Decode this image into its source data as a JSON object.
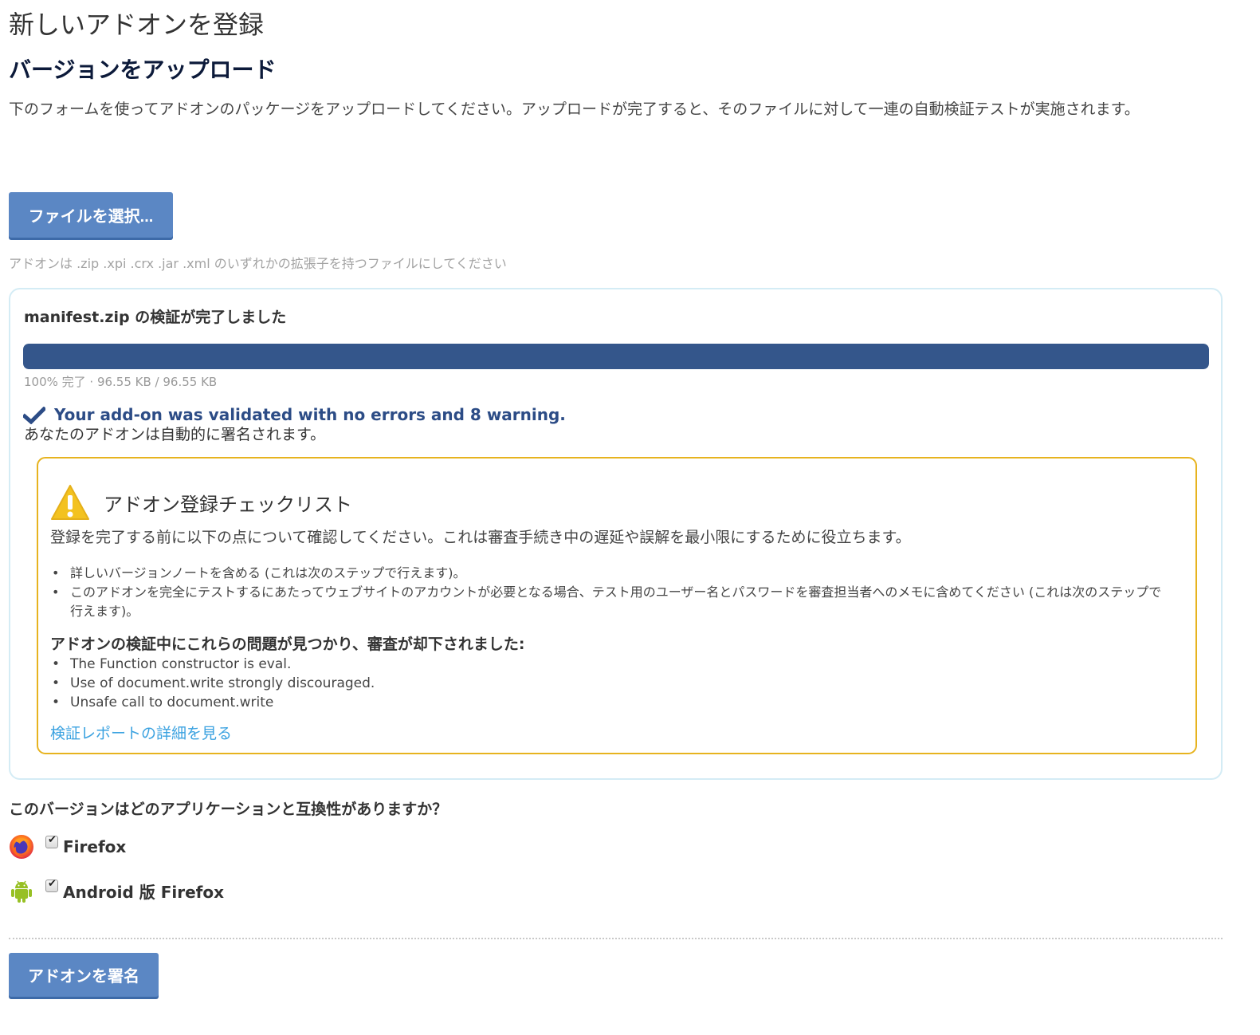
{
  "page": {
    "title": "新しいアドオンを登録",
    "section_title": "バージョンをアップロード",
    "intro": "下のフォームを使ってアドオンのパッケージをアップロードしてください。アップロードが完了すると、そのファイルに対して一連の自動検証テストが実施されます。"
  },
  "upload": {
    "choose_label": "ファイルを選択...",
    "hint": "アドオンは .zip .xpi .crx .jar .xml のいずれかの拡張子を持つファイルにしてください"
  },
  "result": {
    "title": "manifest.zip の検証が完了しました",
    "progress_fraction": 1.0,
    "progress_text": "100% 完了 · 96.55 KB / 96.55 KB",
    "validated_text": "Your add-on was validated with no errors and 8 warning.",
    "auto_sign_text": "あなたのアドオンは自動的に署名されます。"
  },
  "checklist": {
    "title": "アドオン登録チェックリスト",
    "description": "登録を完了する前に以下の点について確認してください。これは審査手続き中の遅延や誤解を最小限にするために役立ちます。",
    "items": [
      "詳しいバージョンノートを含める (これは次のステップで行えます)。",
      "このアドオンを完全にテストするにあたってウェブサイトのアカウントが必要となる場合、テスト用のユーザー名とパスワードを審査担当者へのメモに含めてください (これは次のステップで行えます)。"
    ],
    "issues_heading": "アドオンの検証中にこれらの問題が見つかり、審査が却下されました:",
    "issues": [
      "The Function constructor is eval.",
      "Use of document.write strongly discouraged.",
      "Unsafe call to document.write"
    ],
    "report_link": "検証レポートの詳細を見る"
  },
  "compat": {
    "question": "このバージョンはどのアプリケーションと互換性がありますか？",
    "apps": [
      {
        "label": "Firefox",
        "icon": "firefox-icon",
        "checked": true
      },
      {
        "label": "Android 版 Firefox",
        "icon": "android-icon",
        "checked": true
      }
    ]
  },
  "actions": {
    "sign_label": "アドオンを署名"
  },
  "colors": {
    "button": "#5b87c4",
    "progress": "#34568b",
    "validated": "#2c4c86",
    "warning_border": "#e7b31f",
    "link": "#3ba2e0"
  }
}
